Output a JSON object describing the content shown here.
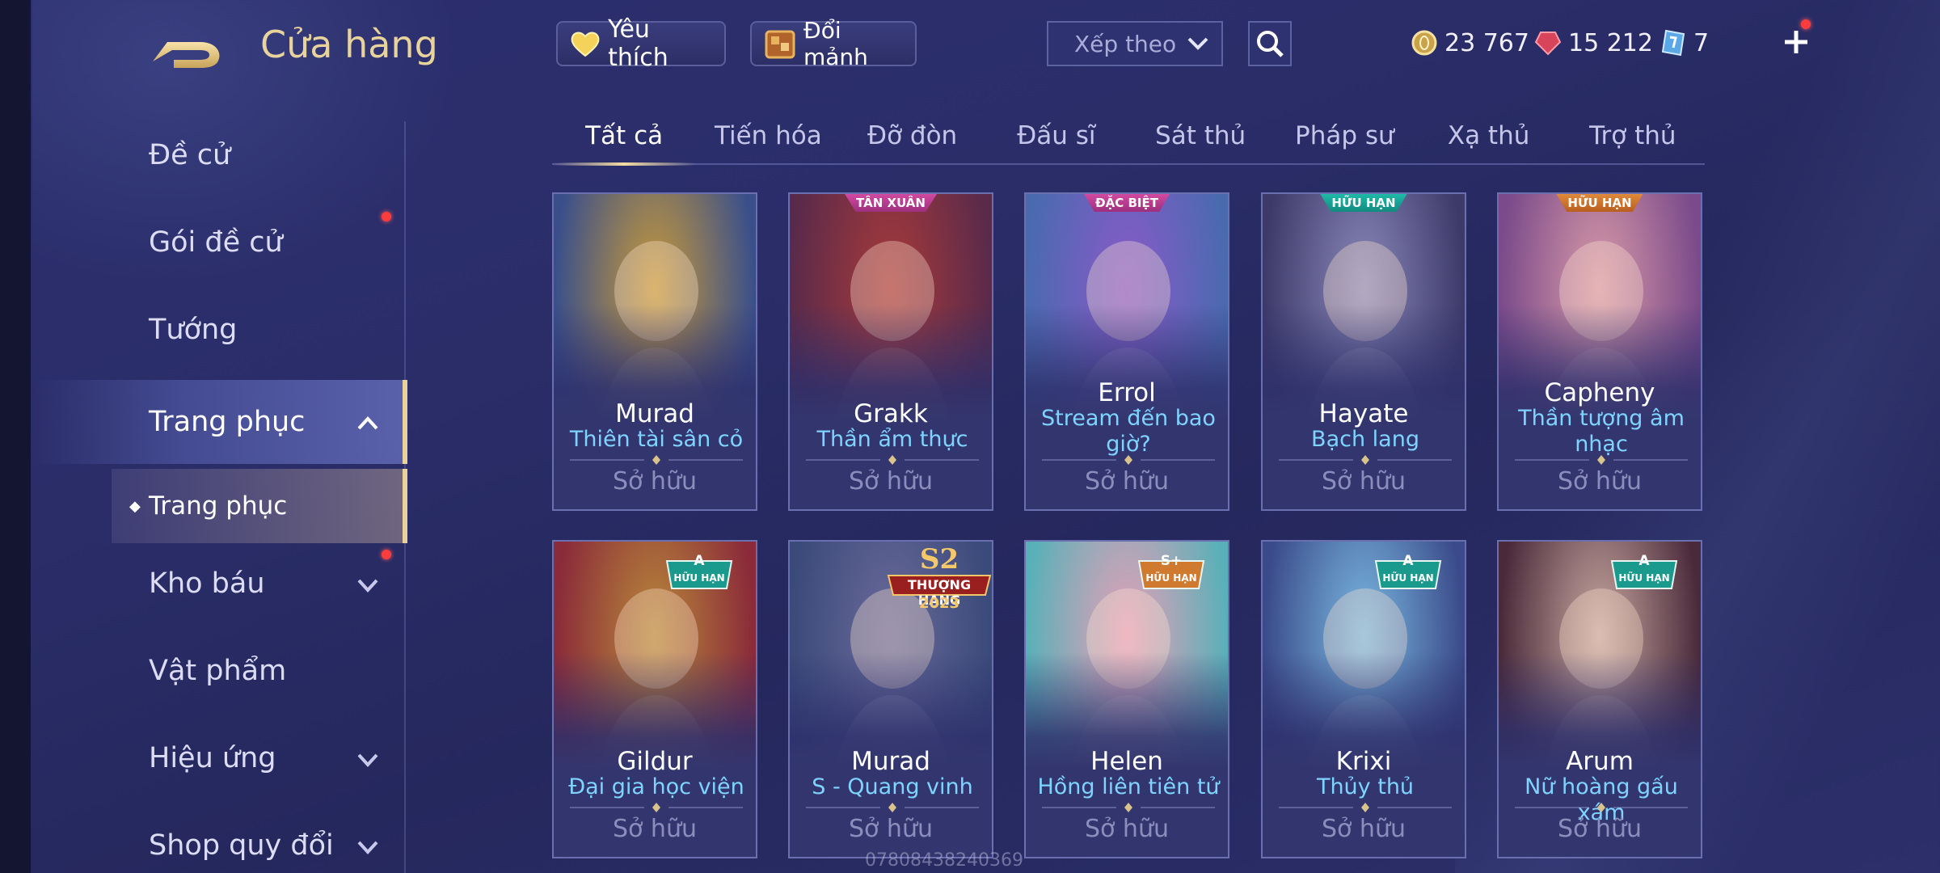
{
  "header": {
    "title": "Cửa hàng",
    "favorite_label": "Yêu thích",
    "fragment_label": "Đổi mảnh",
    "sort_placeholder": "Xếp theo",
    "currencies": [
      {
        "icon": "gold-coin-icon",
        "value": "23 767"
      },
      {
        "icon": "ruby-gem-icon",
        "value": "15 212"
      },
      {
        "icon": "ticket-icon",
        "value": "7"
      }
    ]
  },
  "sidebar": {
    "items": [
      {
        "label": "Đề cử"
      },
      {
        "label": "Gói đề cử"
      },
      {
        "label": "Tướng"
      },
      {
        "label": "Trang phục"
      },
      {
        "label": "Kho báu"
      },
      {
        "label": "Vật phẩm"
      },
      {
        "label": "Hiệu ứng"
      },
      {
        "label": "Shop quy đổi"
      }
    ],
    "sub_item": "Trang phục"
  },
  "tabs": [
    "Tất cả",
    "Tiến hóa",
    "Đỡ đòn",
    "Đấu sĩ",
    "Sát thủ",
    "Pháp sư",
    "Xạ thủ",
    "Trợ thủ"
  ],
  "cards": [
    {
      "hero": "Murad",
      "skin": "Thiên tài sân cỏ",
      "status": "Sở hữu",
      "tag": "",
      "colors": [
        "#c89a3a",
        "#3a4f8a"
      ]
    },
    {
      "hero": "Grakk",
      "skin": "Thần ẩm thực",
      "status": "Sở hữu",
      "tag": "TÂN XUÂN",
      "colors": [
        "#a83a3a",
        "#5a2a4a"
      ]
    },
    {
      "hero": "Errol",
      "skin": "Stream đến bao giờ?",
      "status": "Sở hữu",
      "tag": "ĐẶC BIỆT",
      "colors": [
        "#8a5ac8",
        "#4a6ab0"
      ]
    },
    {
      "hero": "Hayate",
      "skin": "Bạch lang",
      "status": "Sở hữu",
      "tag": "HỮU HẠN",
      "colors": [
        "#8a88b8",
        "#3d3a6a"
      ]
    },
    {
      "hero": "Capheny",
      "skin": "Thần tượng âm nhạc",
      "status": "Sở hữu",
      "tag": "HỮU HẠN",
      "colors": [
        "#d89aa8",
        "#7a4a8a"
      ]
    },
    {
      "hero": "Gildur",
      "skin": "Đại gia học viện",
      "status": "Sở hữu",
      "tag": "A HỮU HẠN",
      "colors": [
        "#b8883a",
        "#8a2a3a"
      ]
    },
    {
      "hero": "Murad",
      "skin": "S - Quang vinh",
      "status": "Sở hữu",
      "tag": "S2 THƯỢNG HẠNG 2023",
      "colors": [
        "#6a6a9a",
        "#3a4a7a"
      ]
    },
    {
      "hero": "Helen",
      "skin": "Hồng liên tiên tử",
      "status": "Sở hữu",
      "tag": "S+ HỮU HẠN",
      "colors": [
        "#e8a0b8",
        "#5ab0b8"
      ]
    },
    {
      "hero": "Krixi",
      "skin": "Thủy thủ",
      "status": "Sở hữu",
      "tag": "A HỮU HẠN",
      "colors": [
        "#7ab8e0",
        "#3a4a8a"
      ]
    },
    {
      "hero": "Arum",
      "skin": "Nữ hoàng gấu xám",
      "status": "Sở hữu",
      "tag": "A HỮU HẠN",
      "colors": [
        "#c8a8a0",
        "#4a2a3a"
      ]
    }
  ],
  "badges": {
    "a_grade": "A",
    "limited": "HỮU HẠN",
    "s_plus": "S+",
    "s2": "S2",
    "s2_line": "THƯỢNG HẠNG",
    "s2_year": "2023",
    "tan_xuan": "TÂN XUÂN",
    "dac_biet": "ĐẶC BIỆT"
  },
  "watermark": "07808438240369",
  "colors": {
    "accent_gold": "#e9d39c",
    "skin_text": "#7fd3ff",
    "owned_text": "#8b8dbc",
    "notify_red": "#ff3b3b"
  }
}
